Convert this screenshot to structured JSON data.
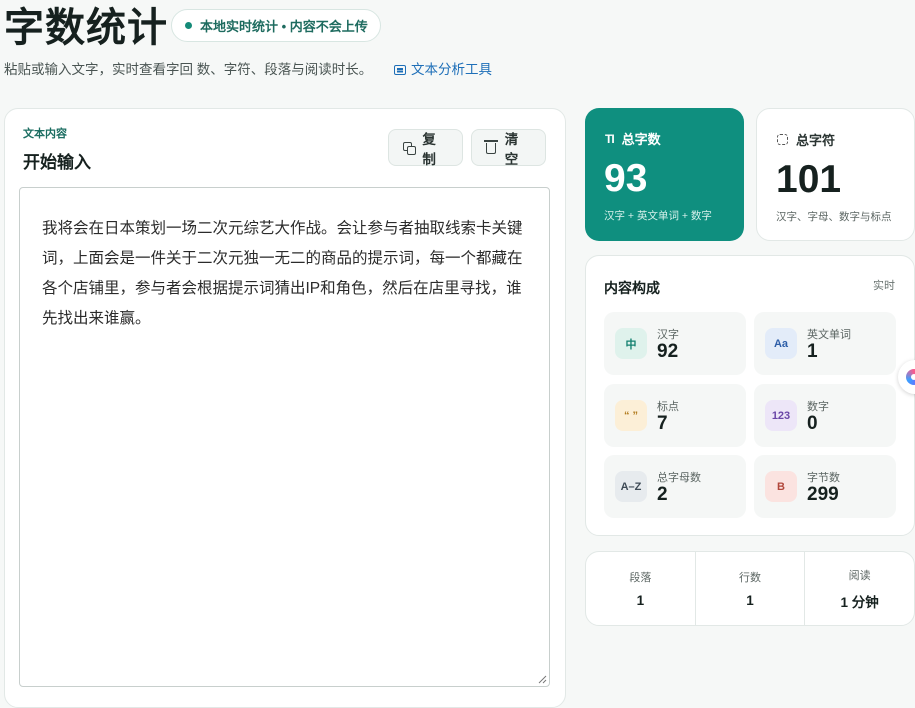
{
  "header": {
    "title": "字数统计",
    "pill_text": "本地实时统计 • 内容不会上传",
    "subtitle": "粘贴或输入文字，实时查看字回 数、字符、段落与阅读时长。",
    "tool_link": "文本分析工具"
  },
  "editor": {
    "kicker": "文本内容",
    "heading": "开始输入",
    "copy_label": "复制",
    "clear_label": "清空",
    "text": "我将会在日本策划一场二次元综艺大作战。会让参与者抽取线索卡关键词，上面会是一件关于二次元独一无二的商品的提示词，每一个都藏在各个店铺里，参与者会根据提示词猜出IP和角色，然后在店里寻找，谁先找出来谁赢。"
  },
  "stats": {
    "total": {
      "label": "总字数",
      "value": "93",
      "note": "汉字 + 英文单词 + 数字"
    },
    "chars": {
      "label": "总字符",
      "value": "101",
      "note": "汉字、字母、数字与标点"
    }
  },
  "composition": {
    "title": "内容构成",
    "live": "实时",
    "items": [
      {
        "badge": "中",
        "label": "汉字",
        "value": "92"
      },
      {
        "badge": "Aa",
        "label": "英文单词",
        "value": "1"
      },
      {
        "badge": "“ ”",
        "label": "标点",
        "value": "7"
      },
      {
        "badge": "123",
        "label": "数字",
        "value": "0"
      },
      {
        "badge": "A–Z",
        "label": "总字母数",
        "value": "2"
      },
      {
        "badge": "B",
        "label": "字节数",
        "value": "299"
      }
    ]
  },
  "meta": {
    "paragraphs": {
      "label": "段落",
      "value": "1"
    },
    "lines": {
      "label": "行数",
      "value": "1"
    },
    "reading": {
      "label": "阅读",
      "value": "1 分钟"
    }
  },
  "colors": {
    "accent": "#0f8f7f",
    "link": "#1e6fb8"
  }
}
